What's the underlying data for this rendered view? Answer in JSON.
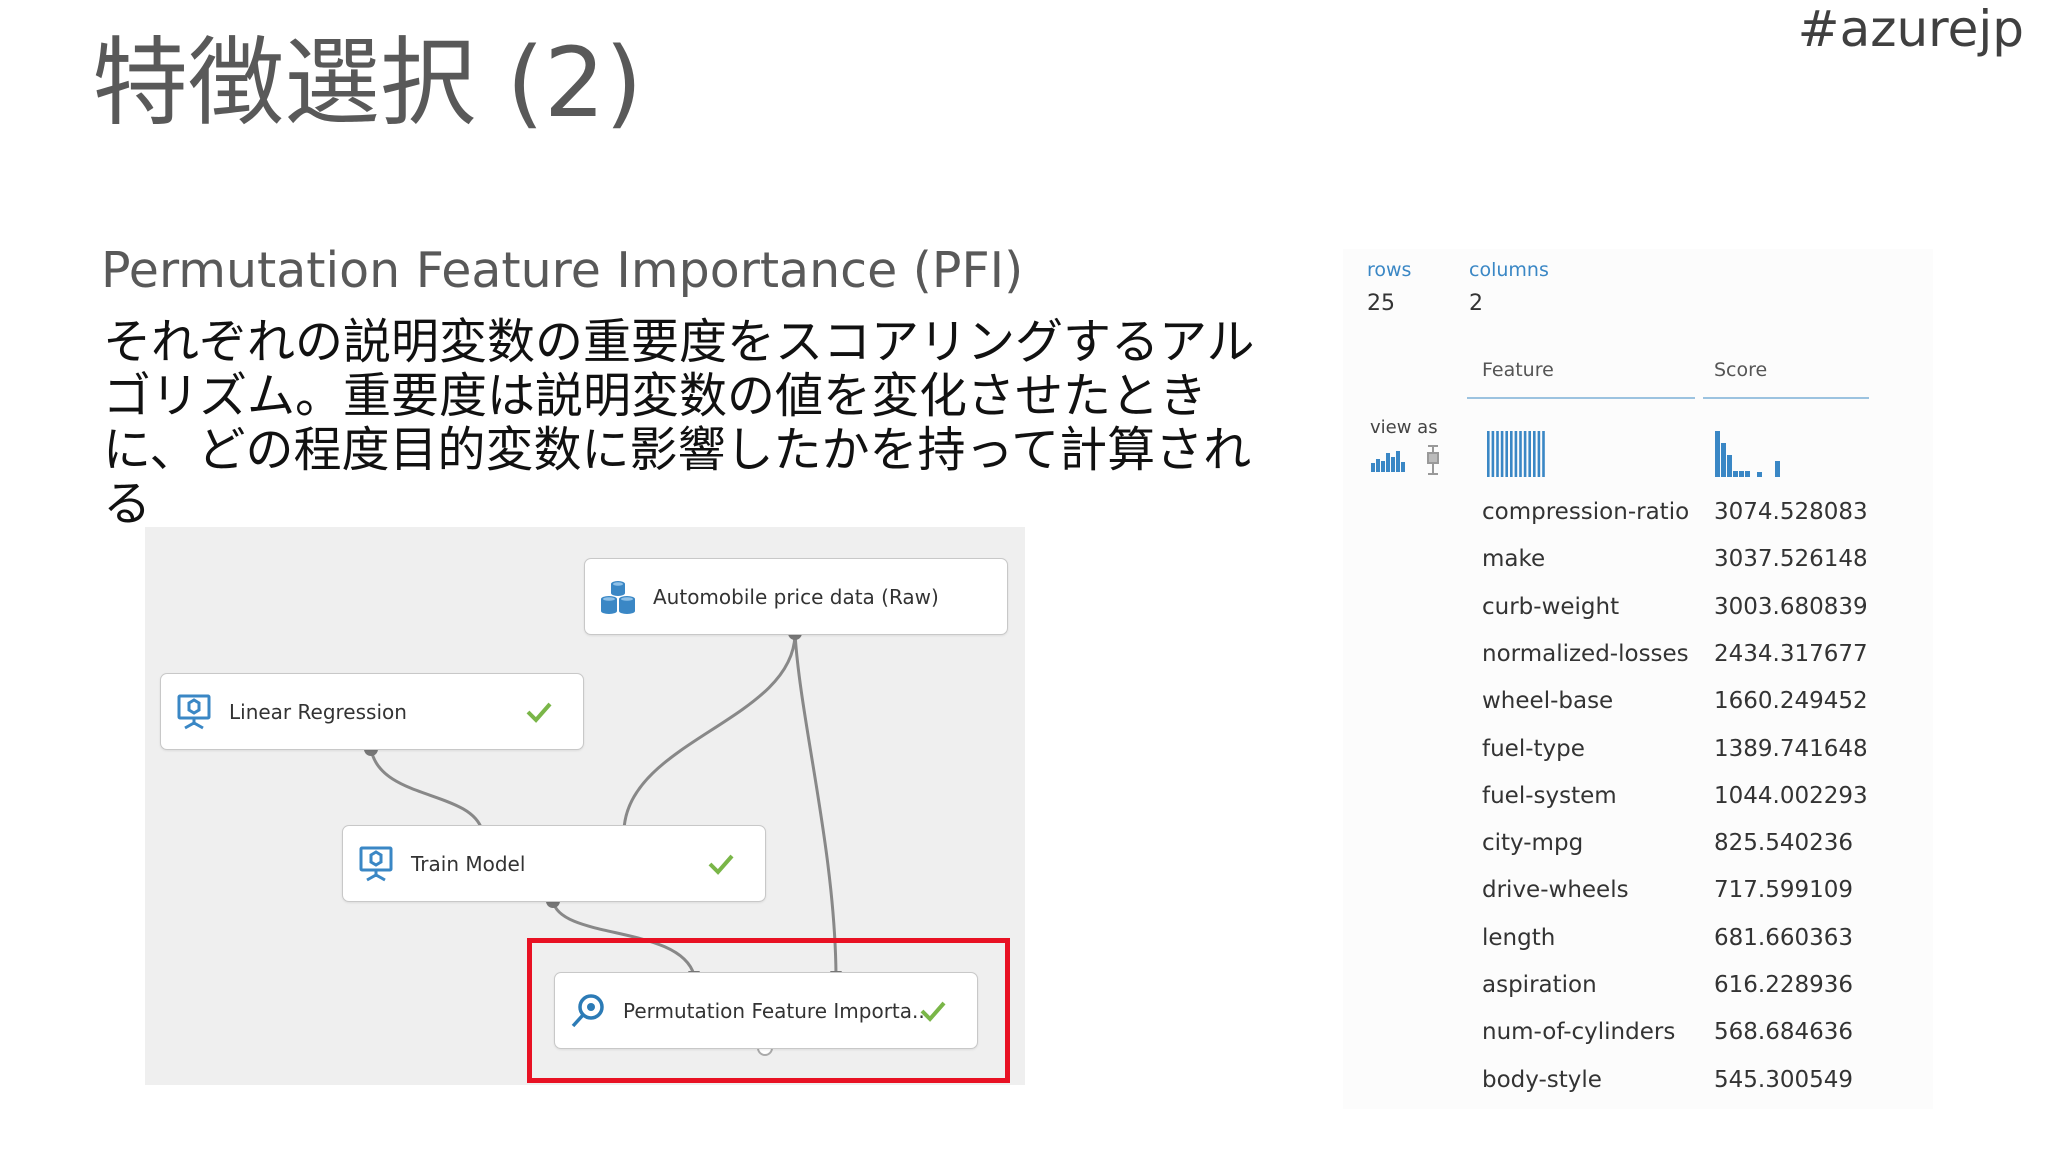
{
  "slide": {
    "title": "特徴選択 (2)",
    "hashtag": "#azurejp",
    "subtitle": "Permutation Feature Importance (PFI)",
    "description": "それぞれの説明変数の重要度をスコアリングするアルゴリズム。重要度は説明変数の値を変化させたときに、どの程度目的変数に影響したかを持って計算される"
  },
  "workflow": {
    "nodes": {
      "dataset": {
        "label": "Automobile price data (Raw)",
        "icon": "dataset-icon"
      },
      "linear_regression": {
        "label": "Linear Regression",
        "icon": "model-icon",
        "status": "check-icon"
      },
      "train_model": {
        "label": "Train Model",
        "icon": "model-icon",
        "status": "check-icon"
      },
      "pfi": {
        "label": "Permutation Feature Importa...",
        "icon": "magnifier-icon",
        "status": "check-icon"
      }
    },
    "highlight_color": "#e81123",
    "check_color": "#7ab648"
  },
  "results": {
    "rows_label": "rows",
    "rows_value": "25",
    "columns_label": "columns",
    "columns_value": "2",
    "view_as_label": "view as",
    "columns": [
      "Feature",
      "Score"
    ],
    "rows": [
      {
        "feature": "compression-ratio",
        "score": "3074.528083"
      },
      {
        "feature": "make",
        "score": "3037.526148"
      },
      {
        "feature": "curb-weight",
        "score": "3003.680839"
      },
      {
        "feature": "normalized-losses",
        "score": "2434.317677"
      },
      {
        "feature": "wheel-base",
        "score": "1660.249452"
      },
      {
        "feature": "fuel-type",
        "score": "1389.741648"
      },
      {
        "feature": "fuel-system",
        "score": "1044.002293"
      },
      {
        "feature": "city-mpg",
        "score": "825.540236"
      },
      {
        "feature": "drive-wheels",
        "score": "717.599109"
      },
      {
        "feature": "length",
        "score": "681.660363"
      },
      {
        "feature": "aspiration",
        "score": "616.228936"
      },
      {
        "feature": "num-of-cylinders",
        "score": "568.684636"
      },
      {
        "feature": "body-style",
        "score": "545.300549"
      }
    ],
    "accent_color": "#3a87c5"
  }
}
